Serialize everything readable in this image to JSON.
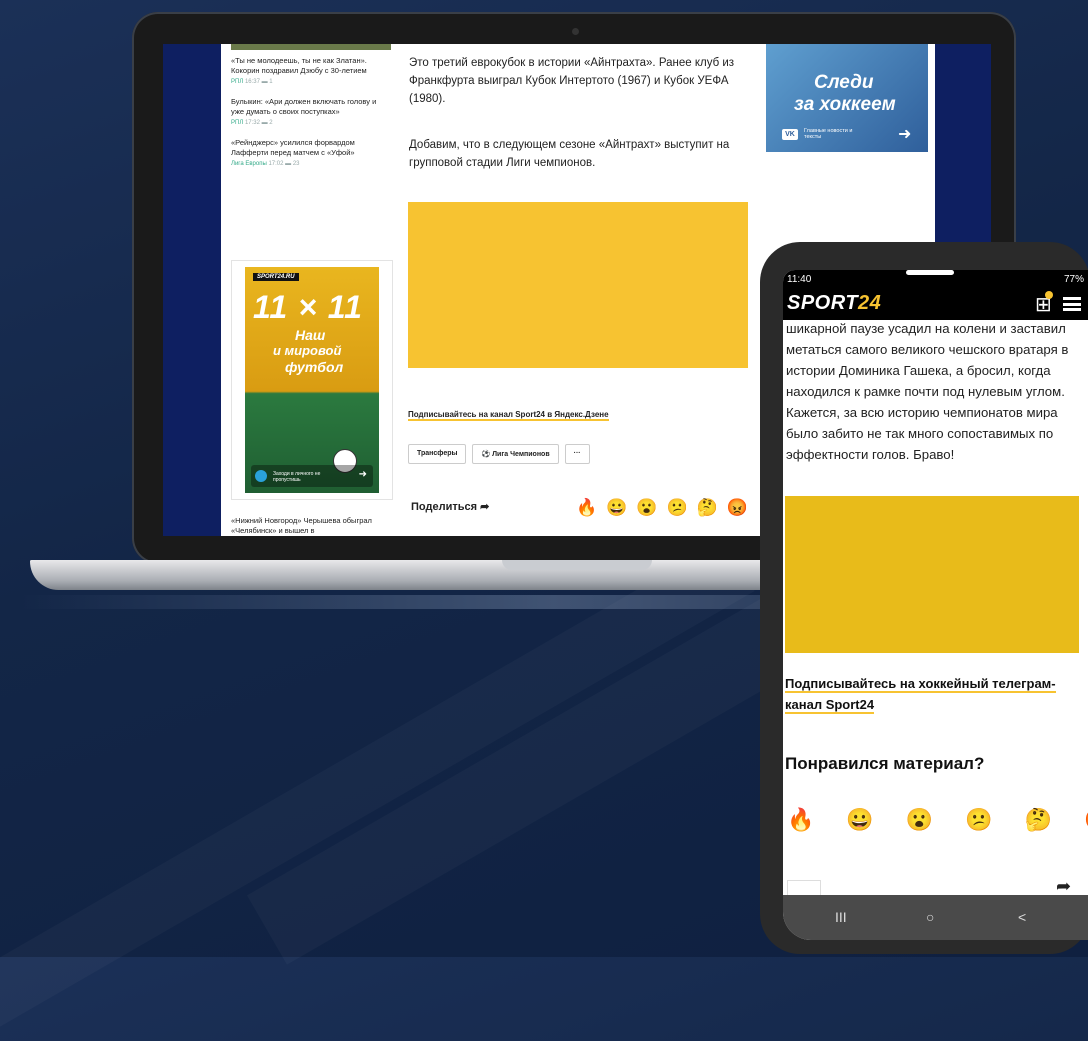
{
  "laptop_page": {
    "side_news": [
      {
        "text": "«Ты не молодеешь, ты не как Златан». Кокорин поздравил Дзюбу с 30-летием",
        "tag": "РПЛ",
        "time": "16:37",
        "comments": "1"
      },
      {
        "text": "Булыкин: «Ари должен включать голову и уже думать о своих поступках»",
        "tag": "РПЛ",
        "time": "17:32",
        "comments": "2"
      },
      {
        "text": "«Рейнджерс» усилился форвардом Лафферти перед матчем с «Уфой»",
        "tag": "Лига Европы",
        "time": "17:02",
        "comments": "23"
      }
    ],
    "promo": {
      "brand": "SPORT24.RU",
      "big": "11 × 11",
      "line1": "Наш",
      "line2": "и мировой",
      "line3": "футбол",
      "cta": "Заходи в личного не пропустишь"
    },
    "side_bottom": "«Нижний Новгород» Черышева обыграл «Челябинск» и вышел в",
    "para1": "Это третий еврокубок в истории «Айнтрахта». Ранее клуб из Франкфурта выиграл Кубок Интертото (1967) и Кубок УЕФА (1980).",
    "para2": "Добавим, что в следующем сезоне «Айнтрахт» выступит на групповой стадии Лиги чемпионов.",
    "subscribe": "Подписывайтесь на канал Sport24 в Яндекс.Дзене",
    "tags": [
      "Трансферы",
      "⚽ Лига Чемпионов",
      "···"
    ],
    "share": "Поделиться ➦",
    "reactions": [
      "🔥",
      "😀",
      "😮",
      "😕",
      "🤔",
      "😡"
    ],
    "vk_ad": {
      "line1": "Следи",
      "line2": "за хоккеем",
      "vk": "VK",
      "text": "Главные новости и тексты",
      "arrow": "➜"
    }
  },
  "phone": {
    "time": "11:40",
    "status_right": "77%",
    "logo_main": "SPORT",
    "logo_num": "24",
    "gift_icon": "⊞",
    "article": "шикарной паузе усадил на колени и заставил метаться самого великого чешского вратаря в истории Доминика Гашека, а бросил, когда находился к рамке почти под нулевым углом. Кажется, за всю историю чемпионатов мира было забито не так много сопоставимых по эффектности голов. Браво!",
    "subscribe": "Подписывайтесь на хоккейный телеграм-канал Sport24",
    "liked": "Понравился материал?",
    "reactions": [
      "🔥",
      "😀",
      "😮",
      "😕",
      "🤔",
      "😡"
    ],
    "share_icon": "➦",
    "nav": {
      "recent": "III",
      "home": "○",
      "back": "<"
    }
  }
}
